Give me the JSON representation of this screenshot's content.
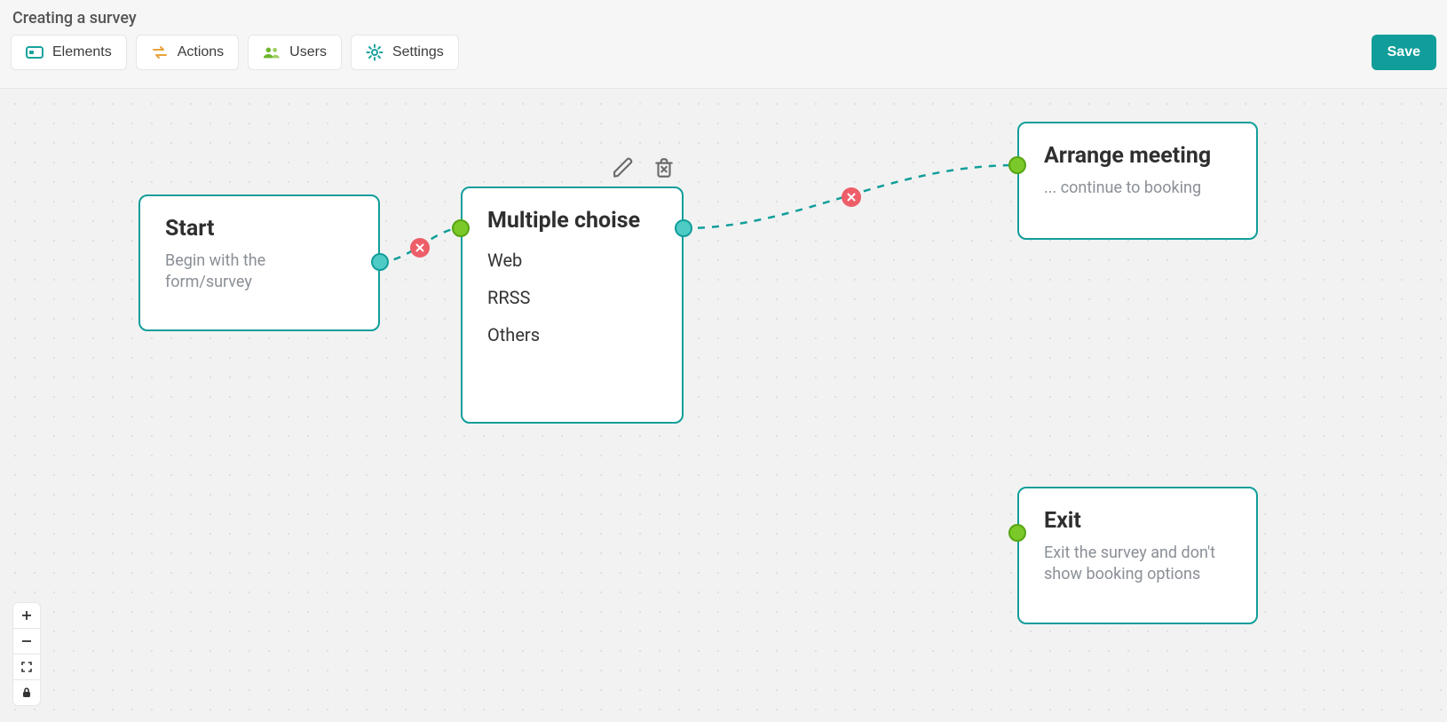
{
  "page": {
    "title": "Creating a survey"
  },
  "toolbar": {
    "elements_label": "Elements",
    "actions_label": "Actions",
    "users_label": "Users",
    "settings_label": "Settings",
    "save_label": "Save"
  },
  "nodes": {
    "start": {
      "title": "Start",
      "subtitle": "Begin with the form/survey"
    },
    "multiple_choice": {
      "title": "Multiple choise",
      "options": [
        "Web",
        "RRSS",
        "Others"
      ]
    },
    "arrange": {
      "title": "Arrange meeting",
      "subtitle": "... continue to booking"
    },
    "exit": {
      "title": "Exit",
      "subtitle": "Exit the survey and don't show booking options"
    }
  },
  "icons": {
    "elements": "elements-icon",
    "actions": "actions-icon",
    "users": "users-icon",
    "settings": "settings-icon",
    "edit": "pencil-icon",
    "trash": "trash-icon",
    "close": "close-icon",
    "plus": "plus-icon",
    "minus": "minus-icon",
    "fullscreen": "fullscreen-icon",
    "lock": "lock-icon"
  },
  "colors": {
    "teal": "#119e9a",
    "lime": "#7ac929",
    "red": "#ed5e68"
  }
}
